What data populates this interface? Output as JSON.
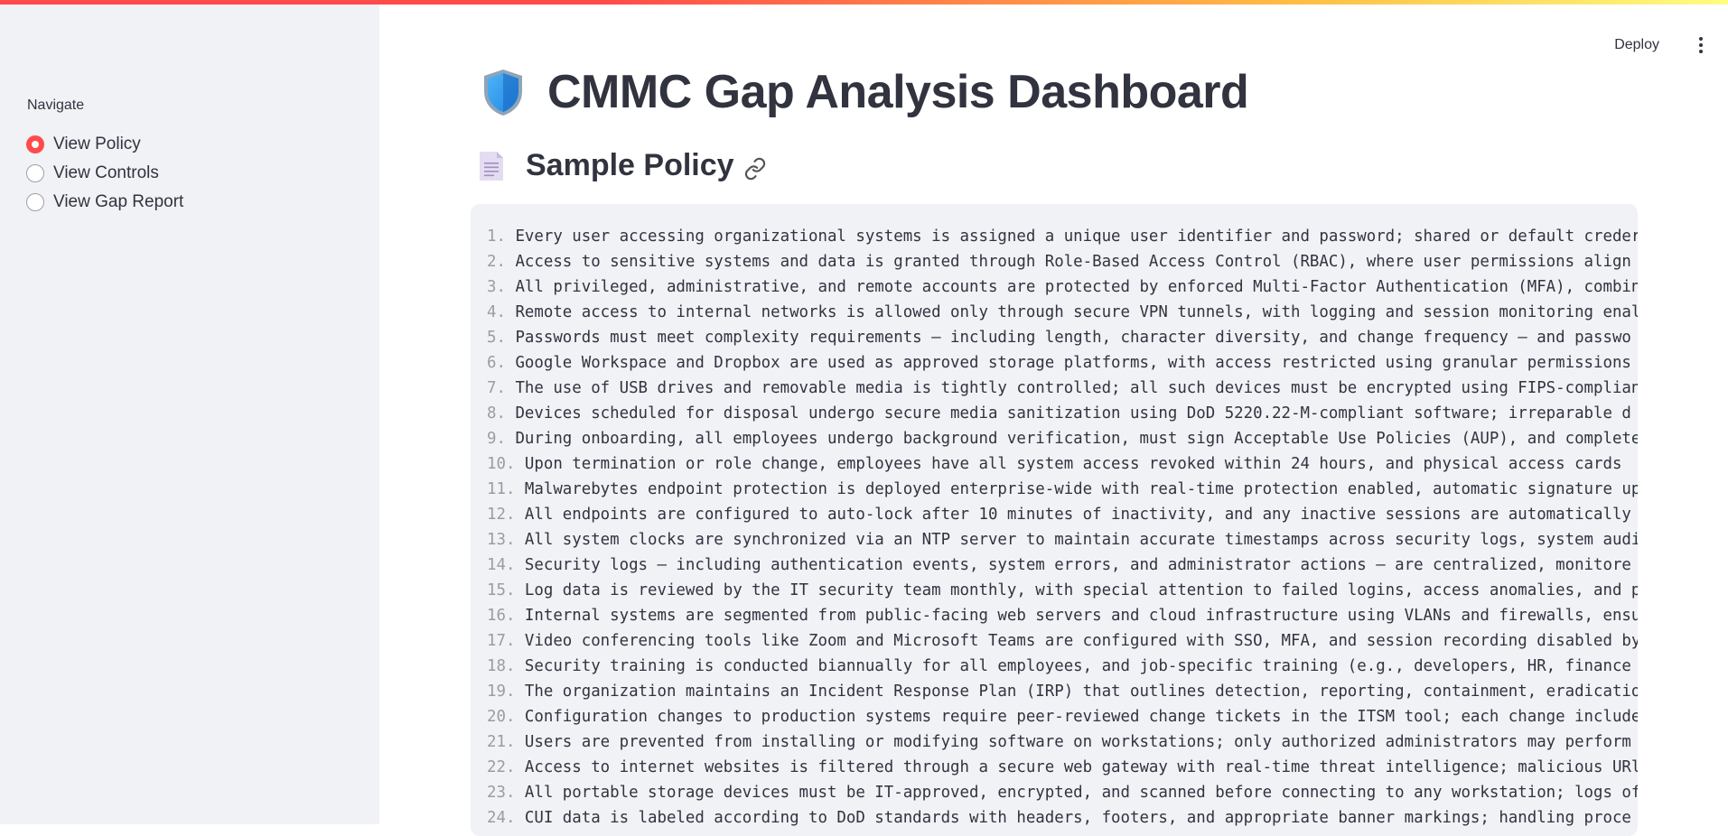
{
  "sidebar": {
    "nav_label": "Navigate",
    "options": [
      {
        "label": "View Policy",
        "selected": true
      },
      {
        "label": "View Controls",
        "selected": false
      },
      {
        "label": "View Gap Report",
        "selected": false
      }
    ]
  },
  "header": {
    "deploy_label": "Deploy",
    "menu_icon": "vertical-ellipsis-icon"
  },
  "main": {
    "title": "CMMC Gap Analysis Dashboard",
    "title_icon": "shield-icon",
    "section_title": "Sample Policy",
    "section_icon": "document-icon",
    "anchor_icon": "link-icon"
  },
  "colors": {
    "accent": "#ff4b4b",
    "sidebar_bg": "#f0f2f6",
    "code_bg": "#f0f2f6",
    "text": "#31333f"
  },
  "policy_lines": [
    {
      "num": "1.",
      "text": "Every user accessing organizational systems is assigned a unique user identifier and password; shared or default creder"
    },
    {
      "num": "2.",
      "text": "Access to sensitive systems and data is granted through Role-Based Access Control (RBAC), where user permissions align"
    },
    {
      "num": "3.",
      "text": "All privileged, administrative, and remote accounts are protected by enforced Multi-Factor Authentication (MFA), combin"
    },
    {
      "num": "4.",
      "text": "Remote access to internal networks is allowed only through secure VPN tunnels, with logging and session monitoring enal"
    },
    {
      "num": "5.",
      "text": "Passwords must meet complexity requirements — including length, character diversity, and change frequency — and passwo"
    },
    {
      "num": "6.",
      "text": "Google Workspace and Dropbox are used as approved storage platforms, with access restricted using granular permissions"
    },
    {
      "num": "7.",
      "text": "The use of USB drives and removable media is tightly controlled; all such devices must be encrypted using FIPS-complian"
    },
    {
      "num": "8.",
      "text": "Devices scheduled for disposal undergo secure media sanitization using DoD 5220.22-M-compliant software; irreparable d"
    },
    {
      "num": "9.",
      "text": "During onboarding, all employees undergo background verification, must sign Acceptable Use Policies (AUP), and complete"
    },
    {
      "num": "10.",
      "text": "Upon termination or role change, employees have all system access revoked within 24 hours, and physical access cards"
    },
    {
      "num": "11.",
      "text": "Malwarebytes endpoint protection is deployed enterprise-wide with real-time protection enabled, automatic signature up"
    },
    {
      "num": "12.",
      "text": "All endpoints are configured to auto-lock after 10 minutes of inactivity, and any inactive sessions are automatically"
    },
    {
      "num": "13.",
      "text": "All system clocks are synchronized via an NTP server to maintain accurate timestamps across security logs, system audi"
    },
    {
      "num": "14.",
      "text": "Security logs — including authentication events, system errors, and administrator actions — are centralized, monitore"
    },
    {
      "num": "15.",
      "text": "Log data is reviewed by the IT security team monthly, with special attention to failed logins, access anomalies, and p"
    },
    {
      "num": "16.",
      "text": "Internal systems are segmented from public-facing web servers and cloud infrastructure using VLANs and firewalls, ensu"
    },
    {
      "num": "17.",
      "text": "Video conferencing tools like Zoom and Microsoft Teams are configured with SSO, MFA, and session recording disabled by"
    },
    {
      "num": "18.",
      "text": "Security training is conducted biannually for all employees, and job-specific training (e.g., developers, HR, finance"
    },
    {
      "num": "19.",
      "text": "The organization maintains an Incident Response Plan (IRP) that outlines detection, reporting, containment, eradicatio"
    },
    {
      "num": "20.",
      "text": "Configuration changes to production systems require peer-reviewed change tickets in the ITSM tool; each change include"
    },
    {
      "num": "21.",
      "text": "Users are prevented from installing or modifying software on workstations; only authorized administrators may perform"
    },
    {
      "num": "22.",
      "text": "Access to internet websites is filtered through a secure web gateway with real-time threat intelligence; malicious URl"
    },
    {
      "num": "23.",
      "text": "All portable storage devices must be IT-approved, encrypted, and scanned before connecting to any workstation; logs of"
    },
    {
      "num": "24.",
      "text": "CUI data is labeled according to DoD standards with headers, footers, and appropriate banner markings; handling proce"
    }
  ]
}
